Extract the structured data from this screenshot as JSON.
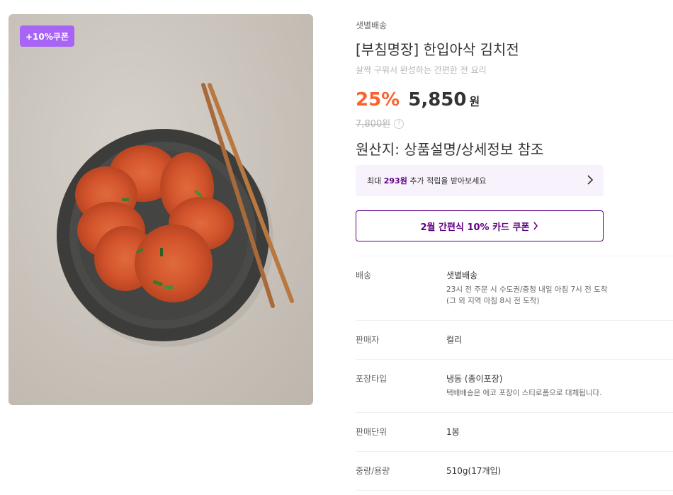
{
  "badge": "+10%쿠폰",
  "product": {
    "delivery_tag": "샛별배송",
    "title": "[부침명장] 한입아삭 김치전",
    "subtitle": "살짝 구워서 완성하는 간편한 전 요리",
    "discount": "25%",
    "price": "5,850",
    "currency": "원",
    "original_price": "7,800원",
    "origin": "원산지: 상품설명/상세정보 참조"
  },
  "points": {
    "prefix": "최대 ",
    "amount": "293원",
    "suffix": " 추가 적립을 받아보세요"
  },
  "card_coupon": "2월 간편식 10% 카드 쿠폰",
  "details": {
    "delivery": {
      "label": "배송",
      "value": "샛별배송",
      "line1": "23시 전 주문 시 수도권/충청 내일 아침 7시 전 도착",
      "line2": "(그 외 지역 아침 8시 전 도착)"
    },
    "seller": {
      "label": "판매자",
      "value": "컬리"
    },
    "packaging": {
      "label": "포장타입",
      "value": "냉동 (종이포장)",
      "note": "택배배송은 에코 포장이 스티로폼으로 대체됩니다."
    },
    "unit": {
      "label": "판매단위",
      "value": "1봉"
    },
    "weight": {
      "label": "중량/용량",
      "value": "510g(17개입)"
    }
  },
  "colors": {
    "accent": "#5f0080",
    "badge": "#a864f5",
    "discount": "#fa622f"
  },
  "icons": {
    "help": "question-circle-icon",
    "chevron": "chevron-right-icon"
  }
}
